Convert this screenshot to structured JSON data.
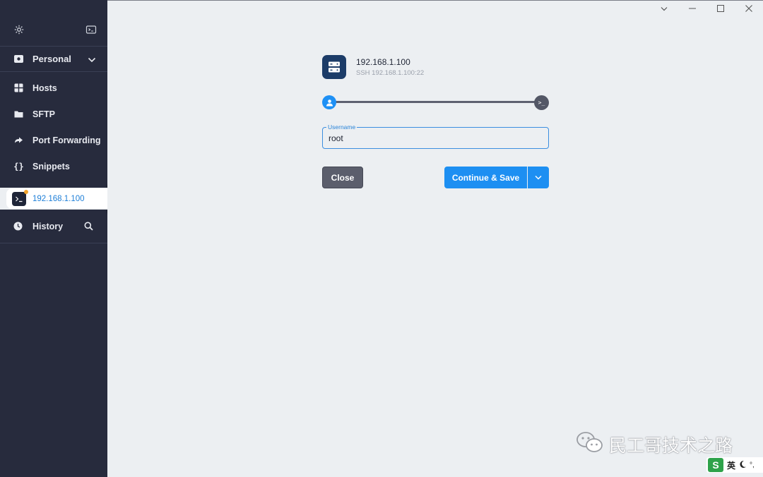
{
  "sidebar": {
    "section": {
      "label": "Personal"
    },
    "items": [
      {
        "label": "Hosts",
        "icon": "hosts-icon"
      },
      {
        "label": "SFTP",
        "icon": "folder-icon"
      },
      {
        "label": "Port Forwarding",
        "icon": "port-forwarding-icon"
      },
      {
        "label": "Snippets",
        "icon": "braces-icon"
      }
    ],
    "active_tab": {
      "label": "192.168.1.100"
    },
    "history": {
      "label": "History"
    }
  },
  "host": {
    "name": "192.168.1.100",
    "subtitle": "SSH 192.168.1.100:22"
  },
  "form": {
    "username_label": "Username",
    "username_value": "root"
  },
  "buttons": {
    "close": "Close",
    "continue_save": "Continue & Save"
  },
  "watermark": {
    "text": "民工哥技术之路"
  },
  "ime": {
    "logo": "S",
    "lang": "英"
  },
  "colors": {
    "sidebar_bg": "#272b3d",
    "accent": "#1d8ff2",
    "content_bg": "#eceff2",
    "host_icon_bg": "#1c3c68",
    "badge": "#f3a42b"
  }
}
